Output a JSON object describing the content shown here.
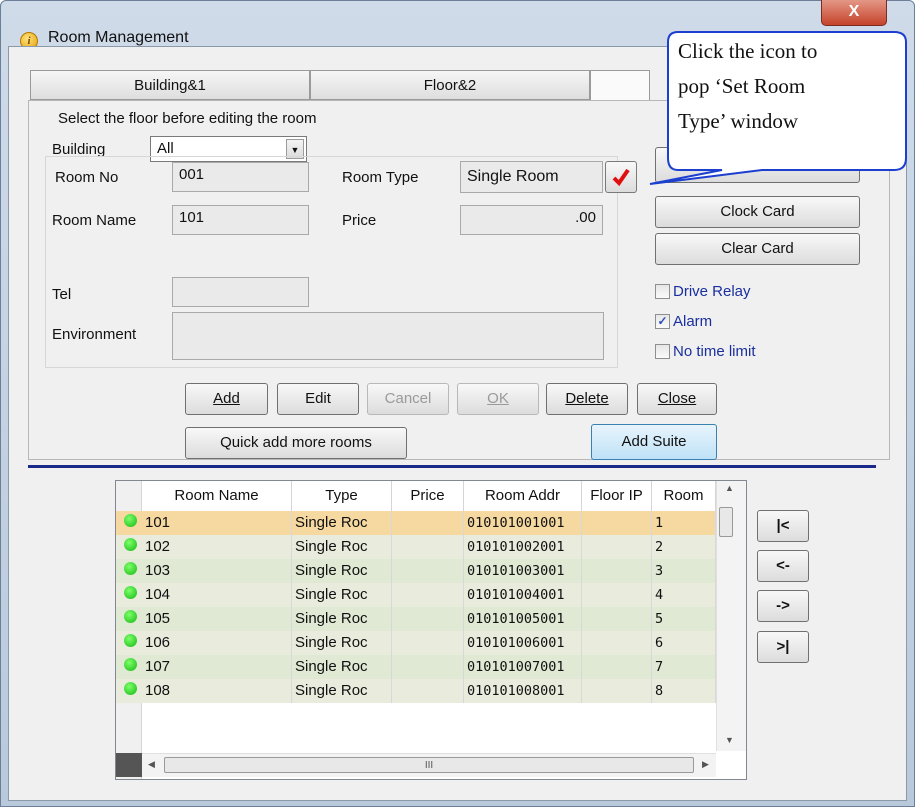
{
  "window": {
    "title": "Room Management",
    "close_label": "X"
  },
  "tabs": [
    {
      "label": "Building&1"
    },
    {
      "label": "Floor&2"
    },
    {
      "label": ""
    }
  ],
  "filter": {
    "instruction": "Select the floor before editing the room",
    "building_label": "Building",
    "building_value": "All"
  },
  "form": {
    "room_no_label": "Room No",
    "room_no": "001",
    "room_name_label": "Room Name",
    "room_name": "101",
    "tel_label": "Tel",
    "tel": "",
    "environment_label": "Environment",
    "environment": "",
    "room_type_label": "Room Type",
    "room_type": "Single Room",
    "price_label": "Price",
    "price": ".00"
  },
  "side_buttons": {
    "clock_card": "Clock Card",
    "clear_card": "Clear Card"
  },
  "options": [
    {
      "label": "Drive Relay",
      "checked": false
    },
    {
      "label": "Alarm",
      "checked": true
    },
    {
      "label": "No time limit",
      "checked": false
    }
  ],
  "actions": {
    "add": "Add",
    "edit": "Edit",
    "cancel": "Cancel",
    "ok": "OK",
    "delete": "Delete",
    "close": "Close",
    "quick_add": "Quick add more rooms",
    "add_suite": "Add Suite"
  },
  "callout": {
    "line1": "Click the icon to",
    "line2": "pop ‘Set Room",
    "line3": "Type’ window"
  },
  "grid": {
    "columns": [
      "Room Name",
      "Type",
      "Price",
      "Room Addr",
      "Floor IP",
      "Room"
    ],
    "rows": [
      {
        "name": "101",
        "type": "Single Roc",
        "price": "",
        "addr": "010101001001",
        "floor_ip": "",
        "room": "1"
      },
      {
        "name": "102",
        "type": "Single Roc",
        "price": "",
        "addr": "010101002001",
        "floor_ip": "",
        "room": "2"
      },
      {
        "name": "103",
        "type": "Single Roc",
        "price": "",
        "addr": "010101003001",
        "floor_ip": "",
        "room": "3"
      },
      {
        "name": "104",
        "type": "Single Roc",
        "price": "",
        "addr": "010101004001",
        "floor_ip": "",
        "room": "4"
      },
      {
        "name": "105",
        "type": "Single Roc",
        "price": "",
        "addr": "010101005001",
        "floor_ip": "",
        "room": "5"
      },
      {
        "name": "106",
        "type": "Single Roc",
        "price": "",
        "addr": "010101006001",
        "floor_ip": "",
        "room": "6"
      },
      {
        "name": "107",
        "type": "Single Roc",
        "price": "",
        "addr": "010101007001",
        "floor_ip": "",
        "room": "7"
      },
      {
        "name": "108",
        "type": "Single Roc",
        "price": "",
        "addr": "010101008001",
        "floor_ip": "",
        "room": "8"
      }
    ],
    "hscroll_grip": "III"
  },
  "nav": {
    "first": "|<",
    "prev": "<-",
    "next": "->",
    "last": ">|"
  },
  "colors": {
    "selected_row": "#f5d9a1",
    "row_a": "#dfe9d3",
    "row_b": "#e9ecdd",
    "divider": "#1a2a88",
    "checkbox_label": "#1a2f9e"
  }
}
